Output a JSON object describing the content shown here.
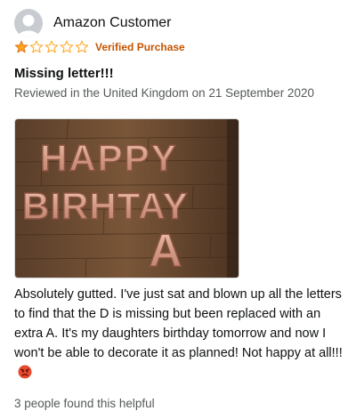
{
  "review": {
    "reviewer_name": "Amazon Customer",
    "avatar_icon": "user-silhouette-icon",
    "rating": 1,
    "rating_max": 5,
    "star_filled_color": "#ffa41c",
    "star_empty_color": "#ffa41c",
    "verified_label": "Verified Purchase",
    "verified_color": "#c45500",
    "title": "Missing letter!!!",
    "location_date": "Reviewed in the United Kingdom on 21 September 2020",
    "photo": {
      "description_icon": "review-photo-balloons",
      "line1": "HAPPY",
      "line2": "BIRHTAY",
      "line3": "A",
      "balloon_color": "#d9a08a"
    },
    "body": "Absolutely gutted. I've just sat and blown up all the letters to find that the D is missing but been replaced with an extra A. It's my daughters birthday tomorrow and now I won't be able to decorate it as planned! Not happy at all!!!",
    "body_emoji_icon": "angry-face-icon",
    "helpful_text": "3 people found this helpful"
  }
}
